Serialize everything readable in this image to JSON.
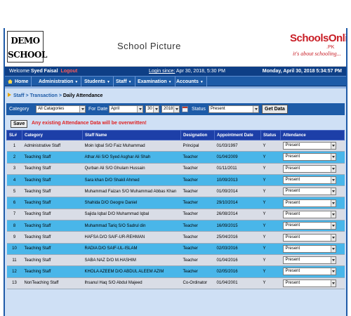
{
  "banner": {
    "logo_line1": "DEMO",
    "logo_line2": "SCHOOL",
    "school_picture": "School Picture",
    "brand": "SchoolsOnline",
    "brand_pk": ".PK",
    "brand_tagline": "it's about schooling...",
    "brand_color": "#c81d25"
  },
  "status": {
    "welcome_label": "Welcome",
    "user_name": "Syed Faisal",
    "logout": "Logout",
    "login_since_label": "Login since:",
    "login_since_value": "Apr 30, 2018, 5:30 PM",
    "now": "Monday, April 30, 2018 5:34:57 PM"
  },
  "nav": {
    "items": [
      "Home",
      "Administration",
      "Students",
      "Staff",
      "Examination",
      "Accounts"
    ]
  },
  "breadcrumb": {
    "staff": "Staff",
    "sep1": ">",
    "transaction": "Transaction",
    "sep2": ">",
    "current": "Daily Attendance"
  },
  "filters": {
    "category_label": "Category",
    "category_value": "All Catagories",
    "for_date_label": "For Date",
    "month": "April",
    "day": "30",
    "year": "2018",
    "status_label": "Status",
    "status_value": "Present",
    "get_data": "Get Data"
  },
  "actions": {
    "save": "Save",
    "warning": "Any existing Attendance Data will be overwritten!"
  },
  "table": {
    "headers": [
      "SL#",
      "Category",
      "Staff Name",
      "Designation",
      "Appointment Date",
      "Status",
      "Attendance"
    ],
    "rows": [
      {
        "sl": "1",
        "category": "Administrative Staff",
        "name": "Moin Iqbal S/O Faiz Muhammad",
        "designation": "Principal",
        "date": "01/03/1997",
        "status": "Y",
        "attendance": "Present"
      },
      {
        "sl": "2",
        "category": "Teaching Staff",
        "name": "Athar Ali S/O Syed Asghar Ali Shah",
        "designation": "Teacher",
        "date": "01/04/2009",
        "status": "Y",
        "attendance": "Present"
      },
      {
        "sl": "3",
        "category": "Teaching Staff",
        "name": "Qurban Ali S/O Ghulam Hussain",
        "designation": "Teacher",
        "date": "01/11/2011",
        "status": "Y",
        "attendance": "Present"
      },
      {
        "sl": "4",
        "category": "Teaching Staff",
        "name": "Sara khan D/O Shakil Ahmed",
        "designation": "Teacher",
        "date": "10/09/2013",
        "status": "Y",
        "attendance": "Present"
      },
      {
        "sl": "5",
        "category": "Teaching Staff",
        "name": "Muhammad Faizan S/O Muhammad Abbas Khan",
        "designation": "Teacher",
        "date": "01/09/2014",
        "status": "Y",
        "attendance": "Present"
      },
      {
        "sl": "6",
        "category": "Teaching Staff",
        "name": "Shahida D/O Geogre Daniel",
        "designation": "Teacher",
        "date": "29/10/2014",
        "status": "Y",
        "attendance": "Present"
      },
      {
        "sl": "7",
        "category": "Teaching Staff",
        "name": "Sajida Iqbal D/O Muhammad Iqbal",
        "designation": "Teacher",
        "date": "26/08/2014",
        "status": "Y",
        "attendance": "Present"
      },
      {
        "sl": "8",
        "category": "Teaching Staff",
        "name": "Muhammad Tariq S/O Sadrul din",
        "designation": "Teacher",
        "date": "16/09/2015",
        "status": "Y",
        "attendance": "Present"
      },
      {
        "sl": "9",
        "category": "Teaching Staff",
        "name": "HAFSA D/O SAIF-UR-REHMAN",
        "designation": "Teacher",
        "date": "25/04/2016",
        "status": "Y",
        "attendance": "Present"
      },
      {
        "sl": "10",
        "category": "Teaching Staff",
        "name": "RADIA D/O SAIF-UL-ISLAM",
        "designation": "Teacher",
        "date": "02/03/2016",
        "status": "Y",
        "attendance": "Present"
      },
      {
        "sl": "11",
        "category": "Teaching Staff",
        "name": "SABA NAZ D/O M.HASHIM",
        "designation": "Teacher",
        "date": "01/04/2016",
        "status": "Y",
        "attendance": "Present"
      },
      {
        "sl": "12",
        "category": "Teaching Staff",
        "name": "KHOLA AZEEM D/O ABDUL ALEEM AZIM",
        "designation": "Teacher",
        "date": "02/05/2016",
        "status": "Y",
        "attendance": "Present"
      },
      {
        "sl": "13",
        "category": "NonTeaching Staff",
        "name": "Ihsanul Haq S/O Abdul Majeed",
        "designation": "Co-Ordinator",
        "date": "01/04/2001",
        "status": "Y",
        "attendance": "Present"
      }
    ]
  },
  "colors": {
    "nav_blue": "#1d5ba7",
    "header_blue": "#1d3fa8",
    "row_alt": "#49b6e9",
    "warning_red": "#e02020"
  }
}
